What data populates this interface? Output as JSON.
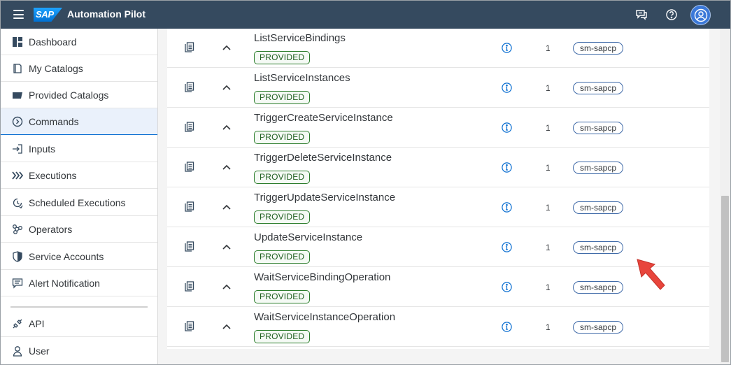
{
  "header": {
    "logo_text": "SAP",
    "app_title": "Automation Pilot"
  },
  "sidebar": {
    "items": [
      {
        "label": "Dashboard",
        "icon": "dashboard-icon",
        "selected": false
      },
      {
        "label": "My Catalogs",
        "icon": "catalog-icon",
        "selected": false
      },
      {
        "label": "Provided Catalogs",
        "icon": "folder-icon",
        "selected": false
      },
      {
        "label": "Commands",
        "icon": "command-icon",
        "selected": true
      },
      {
        "label": "Inputs",
        "icon": "input-icon",
        "selected": false
      },
      {
        "label": "Executions",
        "icon": "executions-icon",
        "selected": false
      },
      {
        "label": "Scheduled Executions",
        "icon": "scheduled-icon",
        "selected": false
      },
      {
        "label": "Operators",
        "icon": "operators-icon",
        "selected": false
      },
      {
        "label": "Service Accounts",
        "icon": "shield-icon",
        "selected": false
      },
      {
        "label": "Alert Notification",
        "icon": "alert-icon",
        "selected": false
      }
    ],
    "footer_items": [
      {
        "label": "API",
        "icon": "api-icon"
      },
      {
        "label": "User",
        "icon": "user-icon"
      }
    ]
  },
  "commands": [
    {
      "name": "ListServiceBindings",
      "status": "PROVIDED",
      "version": "1",
      "tag": "sm-sapcp"
    },
    {
      "name": "ListServiceInstances",
      "status": "PROVIDED",
      "version": "1",
      "tag": "sm-sapcp"
    },
    {
      "name": "TriggerCreateServiceInstance",
      "status": "PROVIDED",
      "version": "1",
      "tag": "sm-sapcp"
    },
    {
      "name": "TriggerDeleteServiceInstance",
      "status": "PROVIDED",
      "version": "1",
      "tag": "sm-sapcp"
    },
    {
      "name": "TriggerUpdateServiceInstance",
      "status": "PROVIDED",
      "version": "1",
      "tag": "sm-sapcp"
    },
    {
      "name": "UpdateServiceInstance",
      "status": "PROVIDED",
      "version": "1",
      "tag": "sm-sapcp"
    },
    {
      "name": "WaitServiceBindingOperation",
      "status": "PROVIDED",
      "version": "1",
      "tag": "sm-sapcp"
    },
    {
      "name": "WaitServiceInstanceOperation",
      "status": "PROVIDED",
      "version": "1",
      "tag": "sm-sapcp"
    }
  ],
  "colors": {
    "shellbar": "#354a5f",
    "accent": "#0a6ed1",
    "badge_green": "#2b7d2b",
    "arrow_red": "#e8453c"
  }
}
